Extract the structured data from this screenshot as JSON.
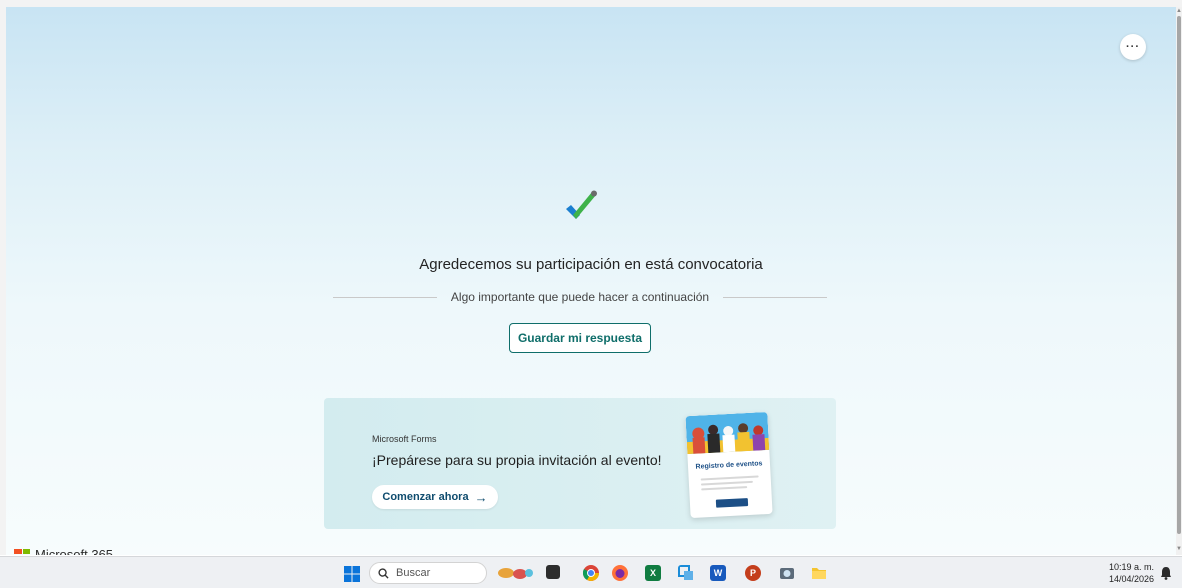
{
  "page": {
    "title": "Agredecemos su participación en está convocatoria",
    "subtitle": "Algo importante que puede hacer a continuación",
    "save_button_label": "Guardar mi respuesta",
    "more_options_glyph": "···"
  },
  "promo": {
    "brand": "Microsoft Forms",
    "headline": "¡Prepárese para su propia invitación al evento!",
    "cta_label": "Comenzar ahora",
    "cta_arrow": "→",
    "card_title": "Registro de eventos"
  },
  "footer": {
    "brand": "Microsoft 365"
  },
  "taskbar": {
    "search_placeholder": "Buscar",
    "clock_time": "10:19 a. m.",
    "clock_date": "14/04/2026",
    "icons": [
      "windows-start-icon",
      "search-icon",
      "widgets-icon",
      "task-view-icon",
      "chrome-icon",
      "firefox-icon",
      "excel-icon",
      "snipping-tool-icon",
      "word-icon",
      "powerpoint-icon",
      "camera-icon",
      "file-explorer-icon"
    ]
  },
  "colors": {
    "accent": "#0f6e6a",
    "promo_link": "#0f4c6e",
    "check_blue": "#1b7fd0",
    "check_green": "#3eb24a"
  }
}
